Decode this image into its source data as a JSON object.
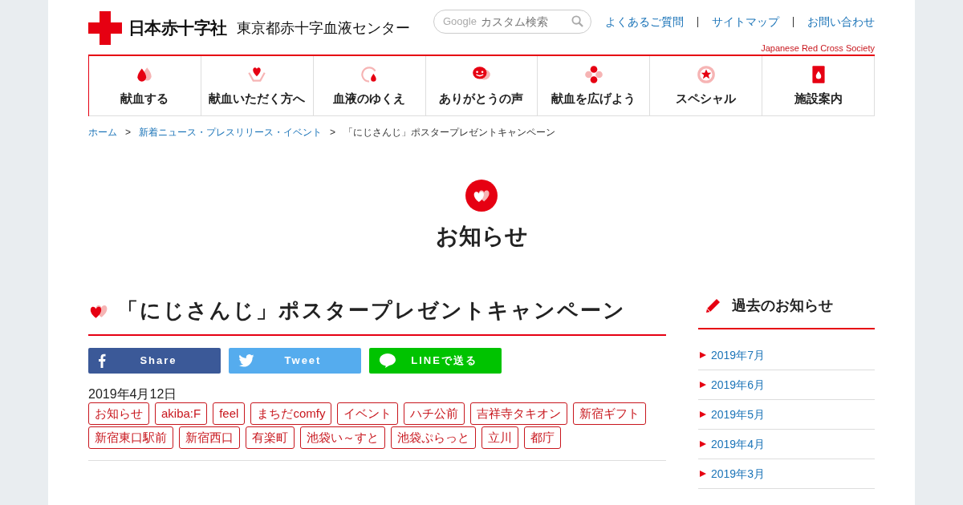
{
  "header": {
    "logo_main": "日本赤十字社",
    "logo_sub": "東京都赤十字血液センター",
    "search": {
      "brand": "Google",
      "placeholder": "カスタム検索"
    },
    "links": [
      "よくあるご質問",
      "サイトマップ",
      "お問い合わせ"
    ],
    "tagline": "Japanese Red Cross Society"
  },
  "nav": [
    {
      "label": "献血する"
    },
    {
      "label": "献血いただく方へ"
    },
    {
      "label": "血液のゆくえ"
    },
    {
      "label": "ありがとうの声"
    },
    {
      "label": "献血を広げよう"
    },
    {
      "label": "スペシャル"
    },
    {
      "label": "施設案内"
    }
  ],
  "breadcrumb": {
    "separator": ">",
    "links": [
      "ホーム",
      "新着ニュース・プレスリリース・イベント"
    ],
    "current": "「にじさんじ」ポスタープレゼントキャンペーン"
  },
  "page_title": "お知らせ",
  "article": {
    "title": "「にじさんじ」ポスタープレゼントキャンペーン",
    "share": [
      {
        "kind": "facebook",
        "label": "Share"
      },
      {
        "kind": "twitter",
        "label": "Tweet"
      },
      {
        "kind": "line",
        "label": "LINEで送る"
      }
    ],
    "date": "2019年4月12日",
    "tags": [
      "お知らせ",
      "akiba:F",
      "feel",
      "まちだcomfy",
      "イベント",
      "ハチ公前",
      "吉祥寺タキオン",
      "新宿ギフト",
      "新宿東口駅前",
      "新宿西口",
      "有楽町",
      "池袋い～すと",
      "池袋ぷらっと",
      "立川",
      "都庁"
    ]
  },
  "sidebar": {
    "title": "過去のお知らせ",
    "items": [
      "2019年7月",
      "2019年6月",
      "2019年5月",
      "2019年4月",
      "2019年3月"
    ]
  }
}
